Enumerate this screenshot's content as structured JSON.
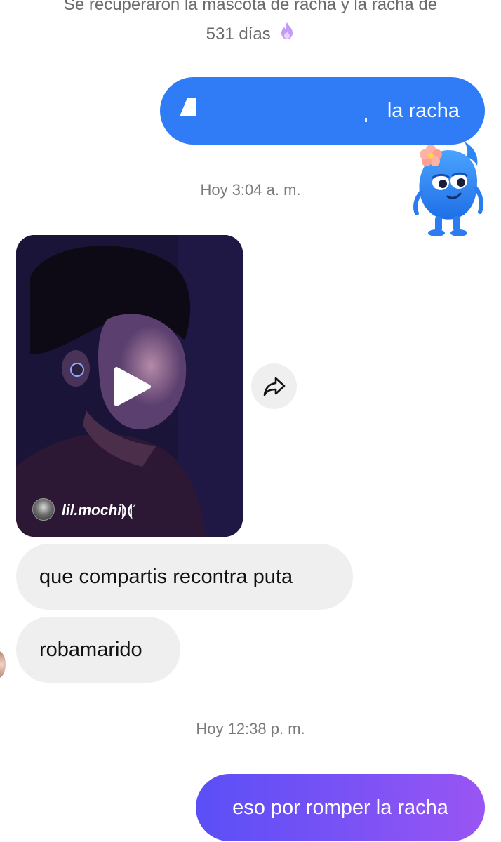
{
  "system_note": {
    "line1": "Se recuperaron la mascota de racha y la racha de",
    "line2": "531 días"
  },
  "messages": {
    "out_streak": {
      "text": "la racha"
    },
    "timestamp_1": "Hoy 3:04 a. m.",
    "video": {
      "author": "lil.mochi",
      "author_suffix": "⁷"
    },
    "in_1": "que compartis recontra puta",
    "in_2": "robamarido",
    "timestamp_2": "Hoy 12:38 p. m.",
    "out_last": "eso por romper la racha"
  },
  "colors": {
    "outgoing_blue": "#2f7cf6",
    "outgoing_gradient_start": "#5a4ff6",
    "outgoing_gradient_end": "#9a55f3",
    "incoming_bg": "#efefef",
    "flame": "#b07cf5"
  },
  "icons": {
    "flame": "flame-icon",
    "share": "share-arrow-icon",
    "play": "play-icon",
    "mascot": "streak-mascot-icon"
  }
}
